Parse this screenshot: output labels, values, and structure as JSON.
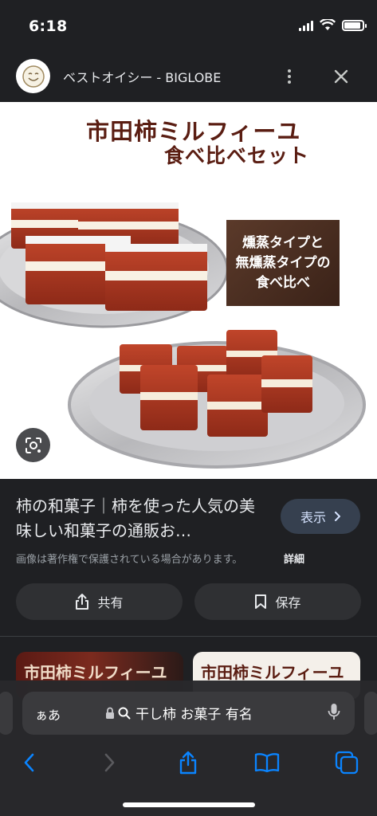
{
  "status_bar": {
    "time": "6:18",
    "battery_level": 0.9
  },
  "site_header": {
    "site_name": "ベストオイシー - BIGLOBE",
    "favicon_icon": "smiley-face-icon",
    "more_icon": "more-vertical-icon",
    "close_icon": "close-icon"
  },
  "image": {
    "title": "市田柿ミルフィーユ",
    "subtitle": "食べ比べセット",
    "promo_lines": [
      "燻蒸タイプと",
      "無燻蒸タイプの",
      "食べ比べ"
    ],
    "lens_icon": "google-lens-icon"
  },
  "result": {
    "title": "柿の和菓子｜柿を使った人気の美味しい和菓子の通販お…",
    "view_label": "表示",
    "copyright_notice": "画像は著作権で保護されている場合があります。",
    "details_label": "詳細",
    "share_label": "共有",
    "save_label": "保存"
  },
  "thumbnails": [
    {
      "text": "市田柿ミルフィーユ"
    },
    {
      "text": "市田柿ミルフィーユ"
    }
  ],
  "browser": {
    "text_size_label": "ぁあ",
    "query": "干し柿 お菓子 有名",
    "lock_icon": "lock-icon",
    "search_icon": "search-icon",
    "mic_icon": "microphone-icon",
    "toolbar_icons": [
      "back-icon",
      "forward-icon",
      "share-icon",
      "bookmarks-icon",
      "tabs-icon"
    ]
  },
  "colors": {
    "accent": "#0a84ff",
    "background": "#1f2023",
    "pill": "#2f3033",
    "view_button": "#36404f"
  }
}
